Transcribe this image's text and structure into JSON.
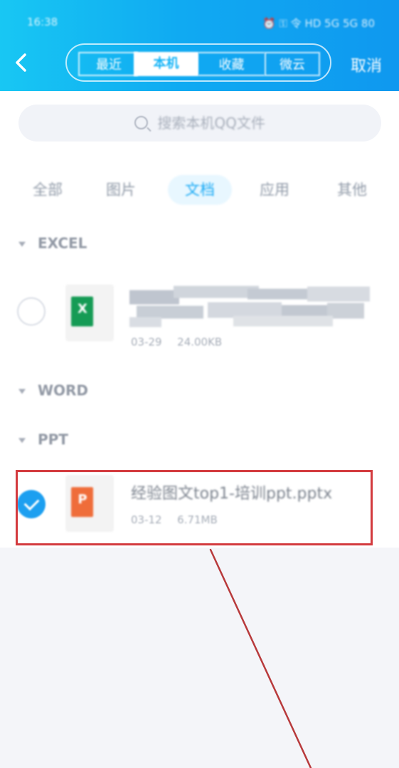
{
  "status_bar": {
    "time": "16:38",
    "icons": "⏰ ⚿ 令 HD 5G 5G 80"
  },
  "navigation": {
    "tabs": [
      {
        "label": "最近"
      },
      {
        "label": "本机"
      },
      {
        "label": "收藏"
      },
      {
        "label": "微云"
      }
    ],
    "cancel_label": "取消"
  },
  "search": {
    "placeholder": "搜索本机QQ文件"
  },
  "filters": [
    {
      "label": "全部"
    },
    {
      "label": "图片"
    },
    {
      "label": "文档"
    },
    {
      "label": "应用"
    },
    {
      "label": "其他"
    }
  ],
  "sections": {
    "excel": "EXCEL",
    "word": "WORD",
    "ppt": "PPT"
  },
  "files": {
    "excel": {
      "date": "03-29",
      "size": "24.00KB",
      "icon_letter": "X",
      "icon_color": "#159b55"
    },
    "ppt": {
      "name": "经验图文top1-培训ppt.pptx",
      "date": "03-12",
      "size": "6.71MB",
      "icon_letter": "P",
      "icon_color": "#ef6d3a"
    }
  },
  "colors": {
    "accent": "#10aaf2",
    "selection": "#d33a3e"
  }
}
